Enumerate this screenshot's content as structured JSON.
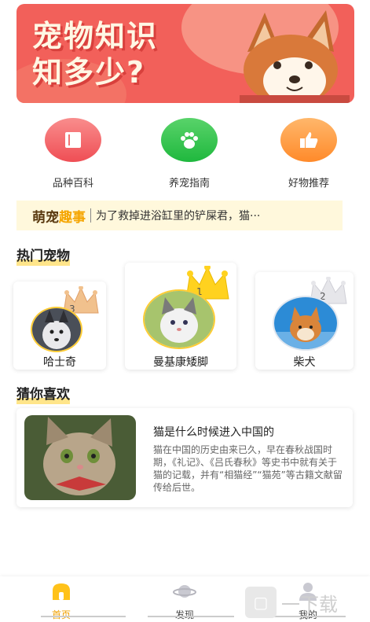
{
  "banner": {
    "line1": "宠物知识",
    "line2": "知多少?"
  },
  "categories": [
    {
      "label": "品种百科",
      "icon": "book-icon"
    },
    {
      "label": "养宠指南",
      "icon": "paw-icon"
    },
    {
      "label": "好物推荐",
      "icon": "thumbs-up-icon"
    }
  ],
  "news": {
    "tag_a": "萌宠",
    "tag_b": "趣事",
    "text": "为了救掉进浴缸里的铲屎君，猫···"
  },
  "hot_pets": {
    "title": "热门宠物",
    "items": [
      {
        "rank": "3",
        "name": "哈士奇"
      },
      {
        "rank": "1",
        "name": "曼基康矮脚"
      },
      {
        "rank": "2",
        "name": "柴犬"
      }
    ]
  },
  "guess": {
    "title": "猜你喜欢",
    "article": {
      "title": "猫是什么时候进入中国的",
      "text": "猫在中国的历史由来已久，早在春秋战国时期，《礼记》、《吕氏春秋》等史书中就有关于猫的记载，并有“相猫经”“猫苑”等古籍文献留传给后世。"
    }
  },
  "nav": {
    "home": "首页",
    "discover": "发现",
    "mine": "我的"
  },
  "watermark": {
    "text": "一下载"
  },
  "colors": {
    "accent": "#f0a000",
    "banner": "#f2605a"
  }
}
